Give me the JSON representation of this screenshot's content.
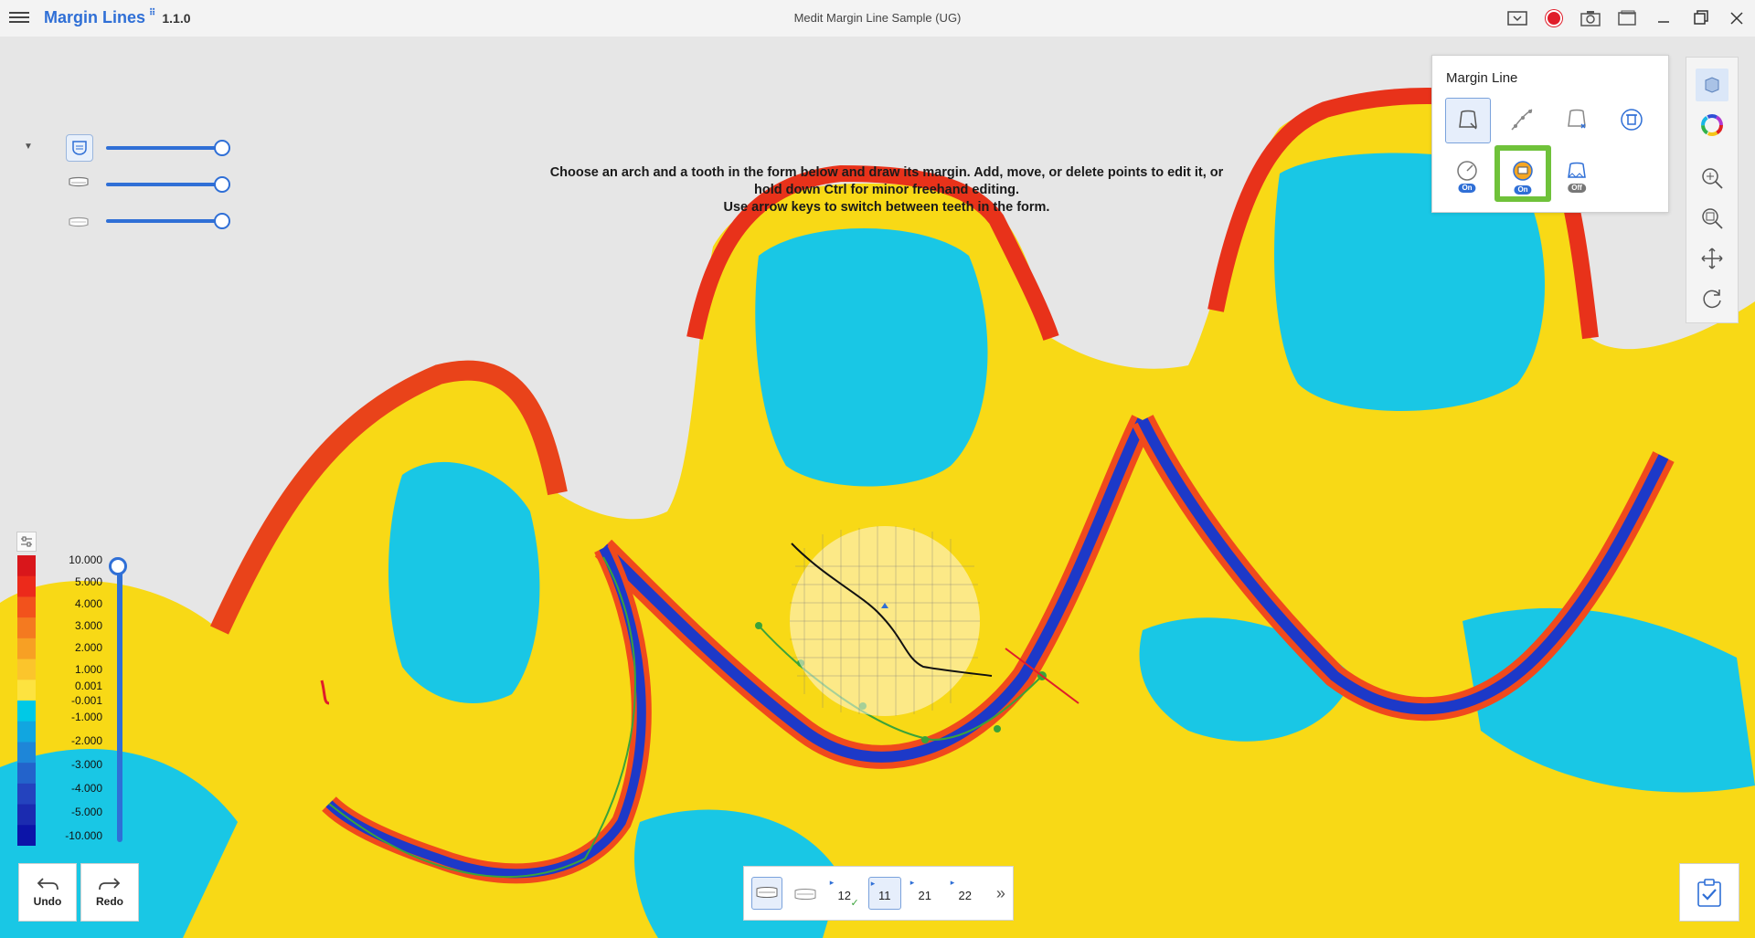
{
  "titlebar": {
    "app_name": "Margin Lines",
    "app_badge": "⠿",
    "version": "1.1.0",
    "window_title": "Medit Margin Line Sample (UG)"
  },
  "instruction": {
    "line1": "Choose an arch and a tooth in the form below and draw its margin. Add, move, or delete points to edit it, or",
    "line2": "hold down Ctrl for minor freehand editing.",
    "line3": "Use arrow keys to switch between teeth in the form."
  },
  "margin_panel": {
    "title": "Margin Line",
    "toggle_on": "On",
    "toggle_off": "Off"
  },
  "legend": {
    "labels": [
      "10.000",
      "5.000",
      "4.000",
      "3.000",
      "2.000",
      "1.000",
      "0.001",
      "-0.001",
      "-1.000",
      "-2.000",
      "-3.000",
      "-4.000",
      "-5.000",
      "-10.000"
    ],
    "colors": [
      "#d9161b",
      "#ec2a1b",
      "#f2521c",
      "#f47a20",
      "#f7a024",
      "#fbc52c",
      "#fde340",
      "#00c9e6",
      "#11a6e0",
      "#1e86d8",
      "#2363cb",
      "#2443be",
      "#1b2bb0",
      "#0c14a8"
    ]
  },
  "undo": {
    "label": "Undo"
  },
  "redo": {
    "label": "Redo"
  },
  "teeth": [
    {
      "num": "12",
      "checked": true,
      "selected": false
    },
    {
      "num": "11",
      "checked": false,
      "selected": true
    },
    {
      "num": "21",
      "checked": false,
      "selected": false
    },
    {
      "num": "22",
      "checked": false,
      "selected": false
    }
  ],
  "more_symbol": "»"
}
